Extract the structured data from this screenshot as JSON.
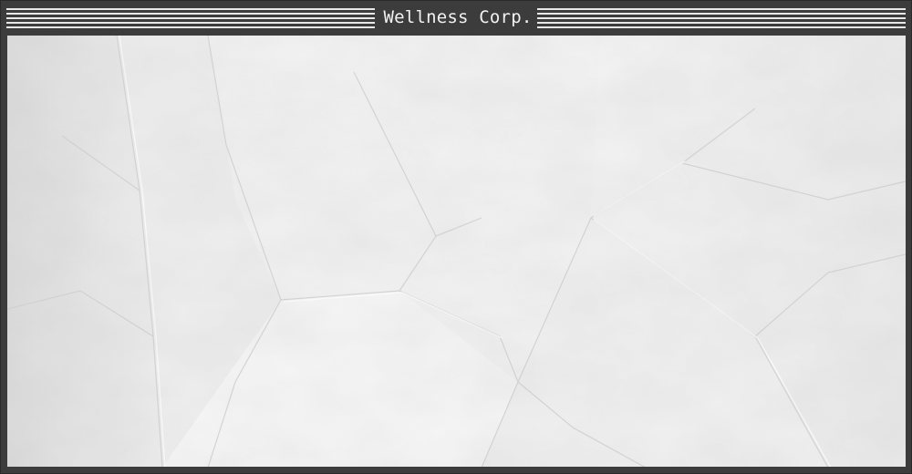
{
  "window": {
    "title": "Wellness Corp.",
    "frame_color": "#3c3c3c",
    "stripe_color": "#e8e8e8",
    "title_color": "#f2f2f2"
  },
  "content": {
    "background": "crumpled-paper-texture",
    "base_color": "#f3f3f3"
  }
}
